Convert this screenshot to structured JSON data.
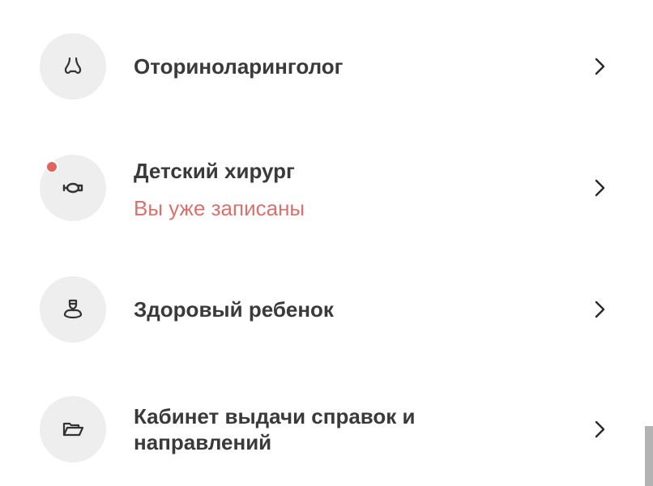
{
  "items": [
    {
      "label": "Оториноларинголог",
      "icon": "nose-icon",
      "subtitle": "",
      "badge": false
    },
    {
      "label": "Детский хирург",
      "icon": "lips-icon",
      "subtitle": "Вы уже записаны",
      "badge": true
    },
    {
      "label": "Здоровый ребенок",
      "icon": "child-icon",
      "subtitle": "",
      "badge": false
    },
    {
      "label": "Кабинет выдачи справок и направлений",
      "icon": "folder-open-icon",
      "subtitle": "",
      "badge": false
    }
  ],
  "colors": {
    "accent": "#e0635e",
    "subtitle": "#d9726d",
    "text": "#3a3a3a",
    "icon_bg": "#eeeeee"
  }
}
